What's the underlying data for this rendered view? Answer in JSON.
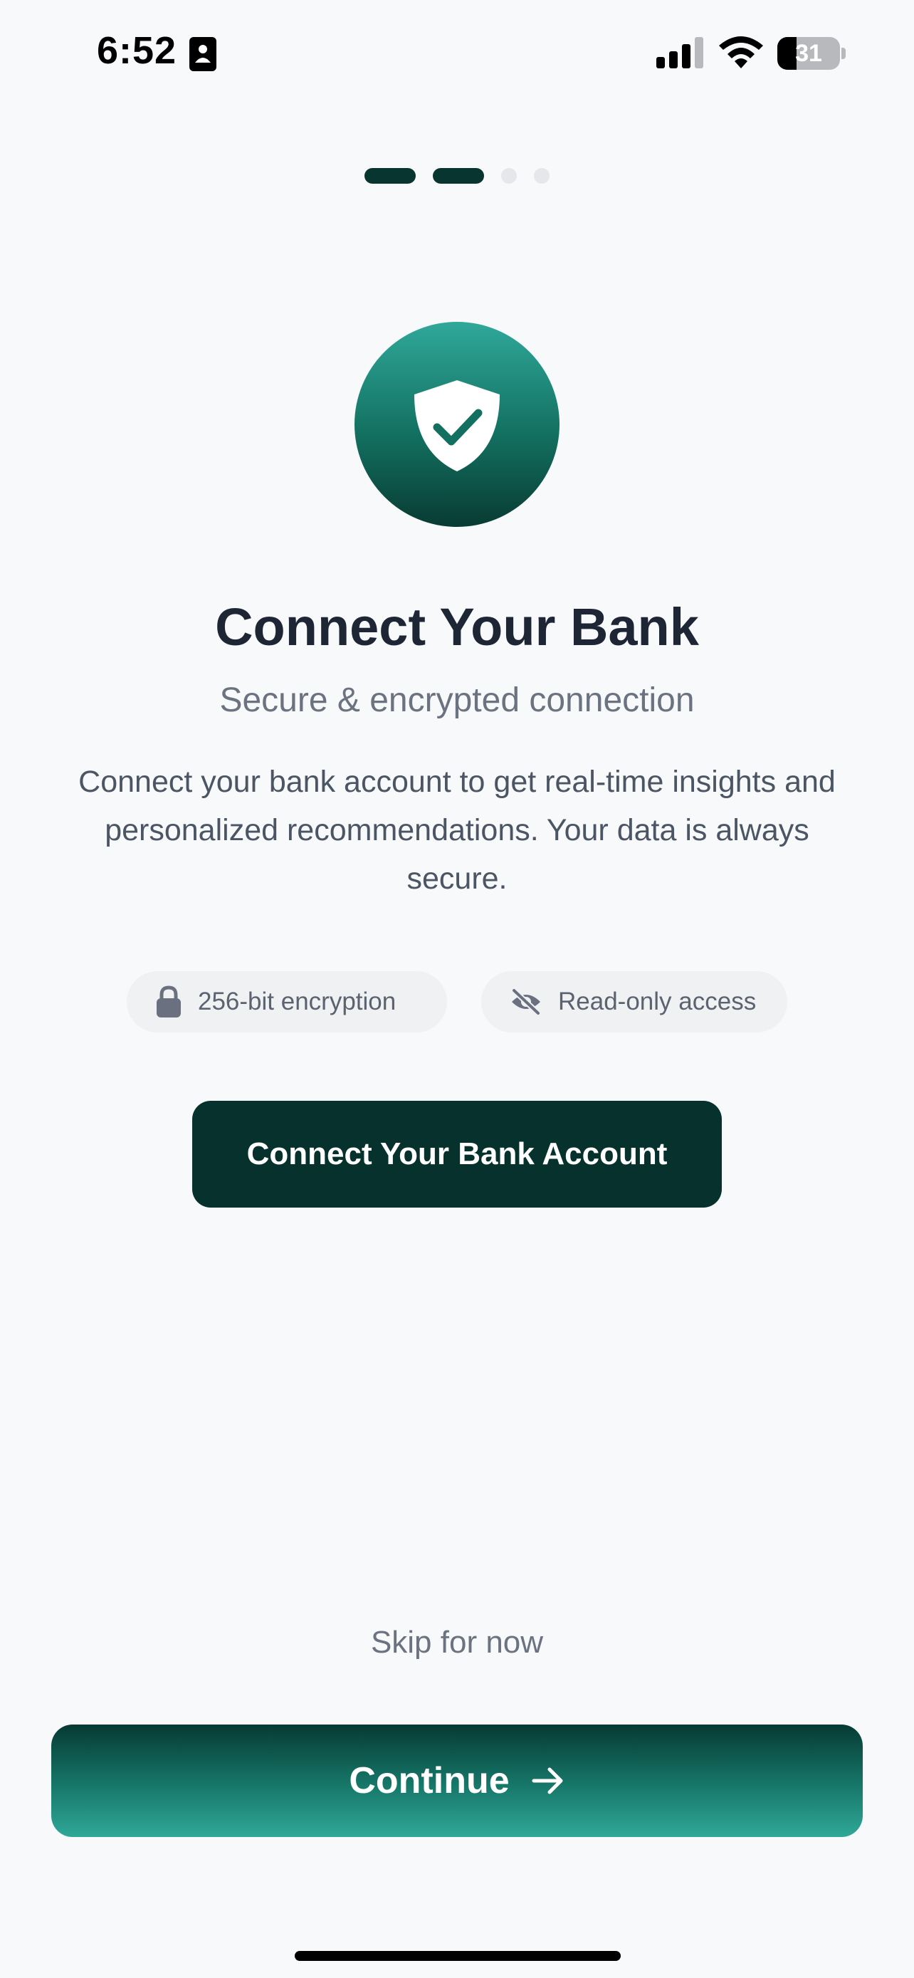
{
  "status_bar": {
    "time": "6:52",
    "battery_percent": "31",
    "battery_level": 0.31
  },
  "progress": {
    "total_steps": 4,
    "completed_steps": 2
  },
  "hero": {
    "icon": "shield-check-icon"
  },
  "header": {
    "title": "Connect Your Bank",
    "subtitle": "Secure & encrypted connection",
    "description": "Connect your bank account to get real-time insights and personalized recommendations. Your data is always secure."
  },
  "features": [
    {
      "icon": "lock-icon",
      "label": "256-bit encryption"
    },
    {
      "icon": "eye-off-icon",
      "label": "Read-only access"
    }
  ],
  "actions": {
    "connect_label": "Connect Your Bank Account",
    "skip_label": "Skip for now",
    "continue_label": "Continue"
  },
  "colors": {
    "background": "#f8f9fb",
    "primary_dark": "#07312c",
    "accent_teal": "#2fa89a",
    "title_text": "#1e2535",
    "muted_text": "#6b7280"
  }
}
